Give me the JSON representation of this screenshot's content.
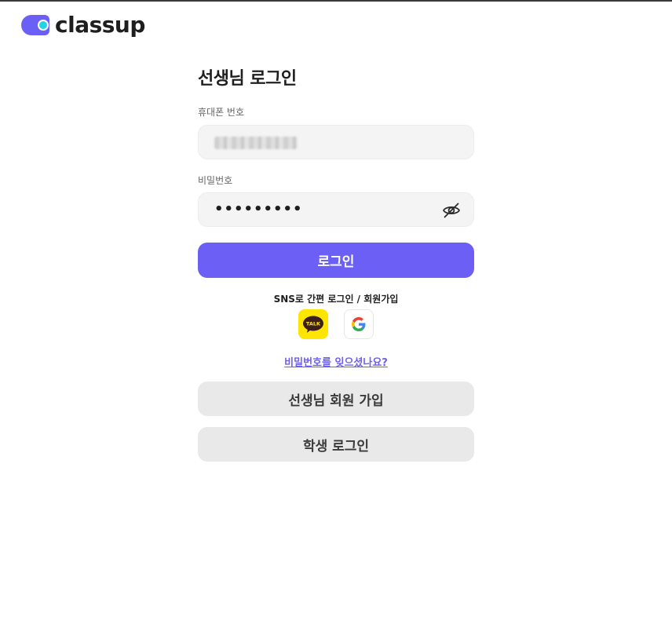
{
  "brand": {
    "name": "classup",
    "accent_color": "#6c5ff5",
    "dot_color": "#22d3e6"
  },
  "login": {
    "title": "선생님 로그인",
    "phone_label": "휴대폰 번호",
    "phone_value": "",
    "password_label": "비밀번호",
    "password_value": "•••••••••",
    "password_toggle_icon": "eye-slash-icon",
    "submit_label": "로그인"
  },
  "sns": {
    "label": "SNS로 간편 로그인 / 회원가입",
    "providers": [
      {
        "name": "kakao",
        "icon": "kakao-talk-icon",
        "badge_text": "TALK",
        "color": "#fee500"
      },
      {
        "name": "google",
        "icon": "google-icon"
      }
    ]
  },
  "links": {
    "forgot_password": "비밀번호를 잊으셨나요?"
  },
  "secondary_buttons": {
    "teacher_signup": "선생님 회원 가입",
    "student_login": "학생 로그인"
  }
}
